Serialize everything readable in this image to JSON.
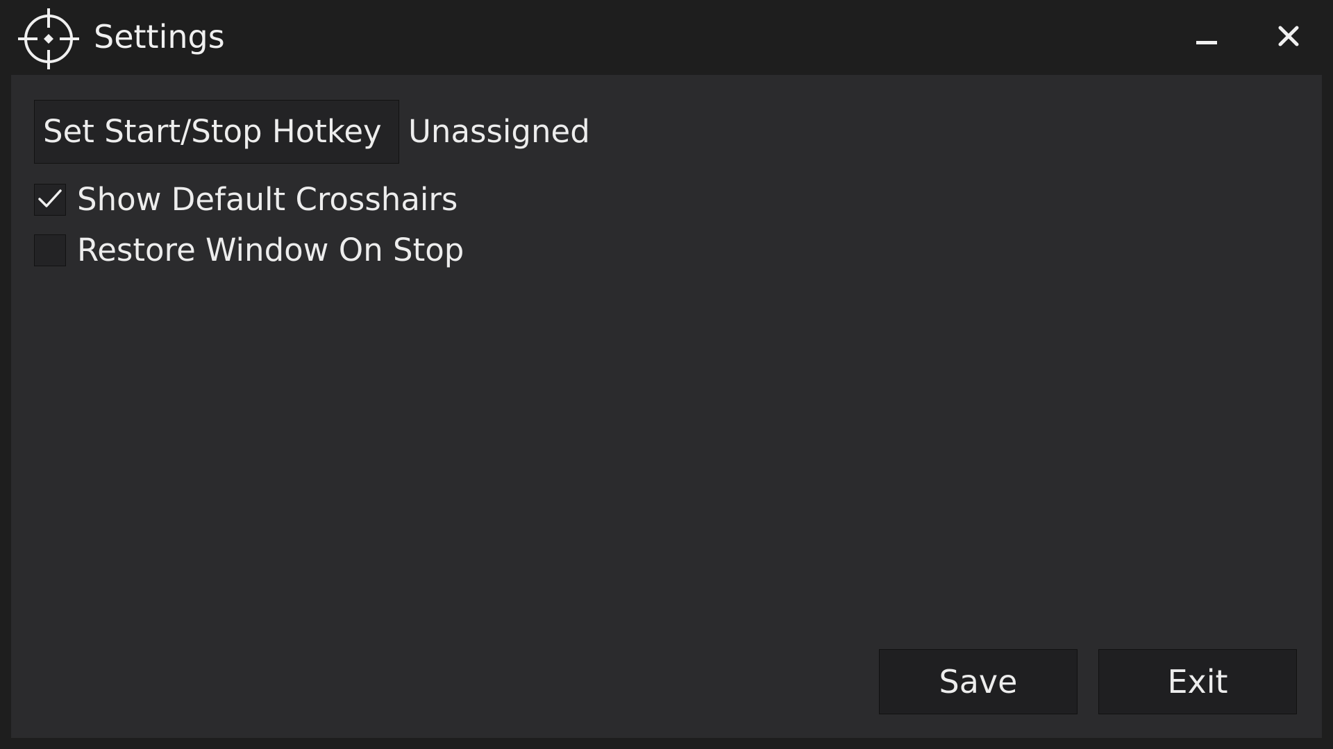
{
  "window": {
    "title": "Settings",
    "icon": "crosshair-icon",
    "controls": {
      "minimize_icon": "minimize-icon",
      "close_icon": "close-icon"
    }
  },
  "hotkey": {
    "button_label": "Set Start/Stop Hotkey",
    "value": "Unassigned"
  },
  "options": [
    {
      "label": "Show Default Crosshairs",
      "checked": true
    },
    {
      "label": "Restore Window On Stop",
      "checked": false
    }
  ],
  "actions": {
    "save_label": "Save",
    "exit_label": "Exit"
  },
  "colors": {
    "titlebar_bg": "#1e1e1e",
    "panel_bg": "#2b2b2d",
    "control_bg": "#232325",
    "text": "#ededed"
  }
}
